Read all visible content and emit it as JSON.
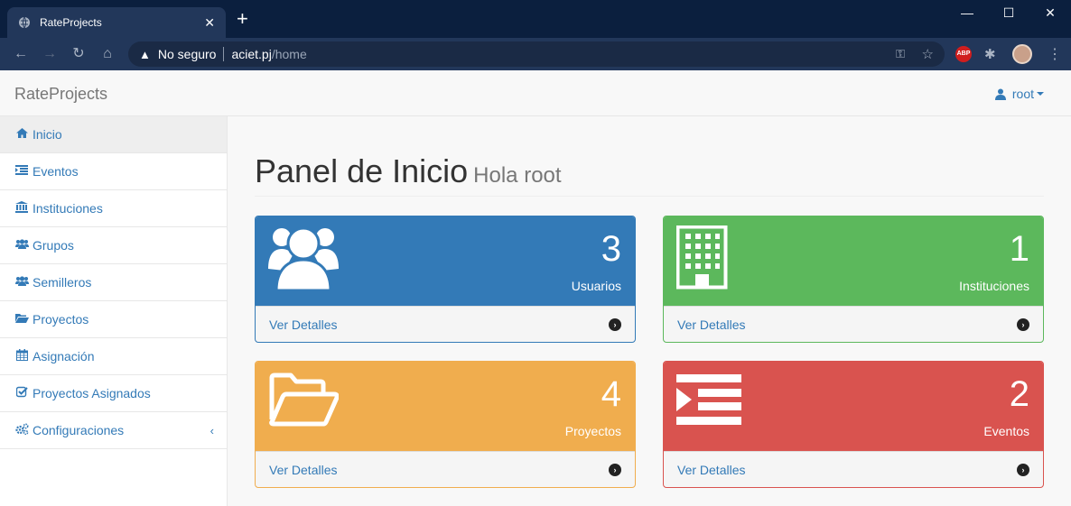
{
  "browser": {
    "tab_title": "RateProjects",
    "security_label": "No seguro",
    "url_host": "aciet.pj",
    "url_path": "/home",
    "abp_label": "ABP"
  },
  "app": {
    "brand": "RateProjects",
    "user": "root"
  },
  "sidebar": {
    "items": [
      {
        "label": "Inicio",
        "icon": "home-icon"
      },
      {
        "label": "Eventos",
        "icon": "indent-icon"
      },
      {
        "label": "Instituciones",
        "icon": "institution-icon"
      },
      {
        "label": "Grupos",
        "icon": "users-icon"
      },
      {
        "label": "Semilleros",
        "icon": "users-icon"
      },
      {
        "label": "Proyectos",
        "icon": "folder-open-icon"
      },
      {
        "label": "Asignación",
        "icon": "calendar-icon"
      },
      {
        "label": "Proyectos Asignados",
        "icon": "check-square-icon"
      },
      {
        "label": "Configuraciones",
        "icon": "cogs-icon"
      }
    ]
  },
  "page": {
    "title": "Panel de Inicio",
    "subtitle": "Hola root"
  },
  "panels": [
    {
      "count": "3",
      "label": "Usuarios",
      "details": "Ver Detalles",
      "color": "#337ab7",
      "icon": "users-icon"
    },
    {
      "count": "1",
      "label": "Instituciones",
      "details": "Ver Detalles",
      "color": "#5cb85c",
      "icon": "building-icon"
    },
    {
      "count": "4",
      "label": "Proyectos",
      "details": "Ver Detalles",
      "color": "#f0ad4e",
      "icon": "folder-open-icon"
    },
    {
      "count": "2",
      "label": "Eventos",
      "details": "Ver Detalles",
      "color": "#d9534f",
      "icon": "indent-icon"
    }
  ]
}
